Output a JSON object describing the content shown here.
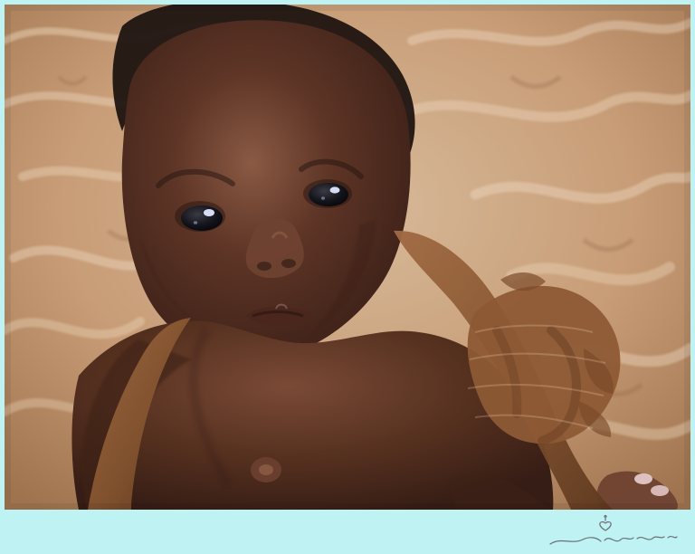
{
  "colors": {
    "frame_border": "#bff2f3",
    "fur_light": "#d8bb9b",
    "fur_mid": "#b98d66",
    "fur_dark": "#8c623f",
    "skin_dark": "#4a2a1f",
    "skin_mid": "#6f4231",
    "skin_highlight": "#9c6a53",
    "wrap_brown": "#8d5a35",
    "wrap_dark": "#6e4125",
    "eye_dark": "#13141c",
    "eye_highlight": "#dfe8ff",
    "watermark_color": "#6c6f76"
  },
  "watermark": {
    "icon_name": "heart-hanger-icon",
    "text_note": "signature"
  }
}
